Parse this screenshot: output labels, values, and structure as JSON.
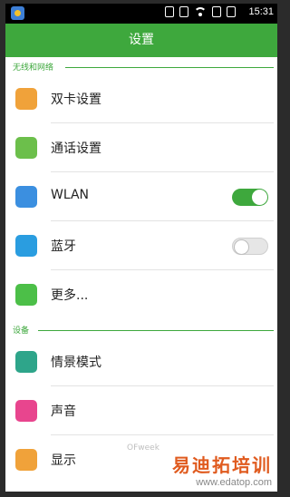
{
  "status": {
    "time": "15:31"
  },
  "header": {
    "title": "设置"
  },
  "sections": {
    "wireless": "无线和网络",
    "device": "设备"
  },
  "items": {
    "dual_sim": "双卡设置",
    "call": "通话设置",
    "wlan": "WLAN",
    "bluetooth": "蓝牙",
    "more": "更多...",
    "scene": "情景模式",
    "sound": "声音",
    "display": "显示"
  },
  "toggles": {
    "wlan": true,
    "bluetooth": false
  },
  "colors": {
    "accent": "#3ea83d",
    "dual_sim": "#f0a23a",
    "call": "#6cbf4b",
    "wlan": "#3b8fe0",
    "bluetooth": "#2a9de0",
    "more": "#4cbf48",
    "scene": "#2ea58a",
    "sound": "#e8458e",
    "display": "#f0a23a"
  },
  "watermark": {
    "brand": "易迪拓培训",
    "url": "www.edatop.com",
    "ofweek": "OFweek"
  }
}
